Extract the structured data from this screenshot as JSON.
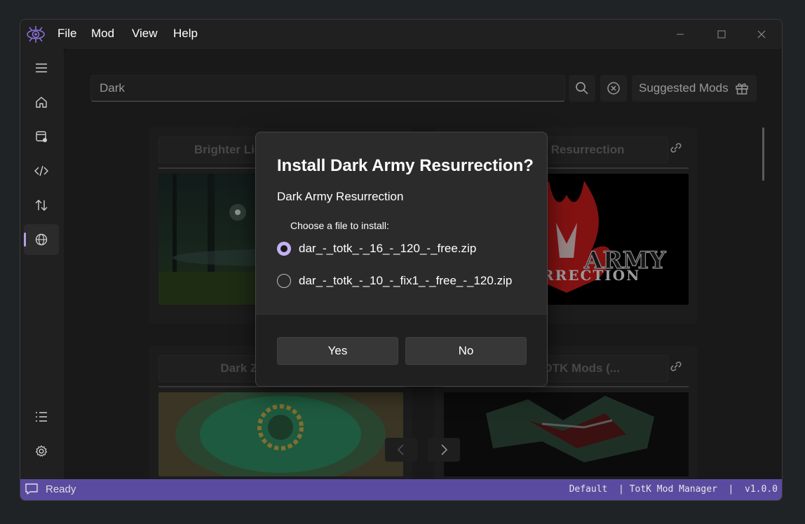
{
  "menu": [
    "File",
    "Mod",
    "View",
    "Help"
  ],
  "search": {
    "value": "Dark"
  },
  "toolbar": {
    "suggested_label": "Suggested Mods"
  },
  "cards": [
    {
      "title": "Brighter Lights & Shadows"
    },
    {
      "title": "Dark Army Resurrection"
    },
    {
      "title": "Dark Zonai Armor"
    },
    {
      "title": "Best of TOTK Mods (..."
    }
  ],
  "dialog": {
    "title": "Install Dark Army Resurrection?",
    "subtitle": "Dark Army Resurrection",
    "choose_label": "Choose a file to install:",
    "options": [
      {
        "label": "dar_-_totk_-_16_-_120_-_free.zip",
        "selected": true
      },
      {
        "label": "dar_-_totk_-_10_-_fix1_-_free_-_120.zip",
        "selected": false
      }
    ],
    "yes_label": "Yes",
    "no_label": "No"
  },
  "art": {
    "army_text": "ARMY",
    "resurrection_text": "RRECTION"
  },
  "status": {
    "text": "Ready",
    "right": "Default  | TotK Mod Manager  |  v1.0.0"
  },
  "colors": {
    "accent": "#5b4ba0",
    "radio_accent": "#c5b0f3"
  }
}
